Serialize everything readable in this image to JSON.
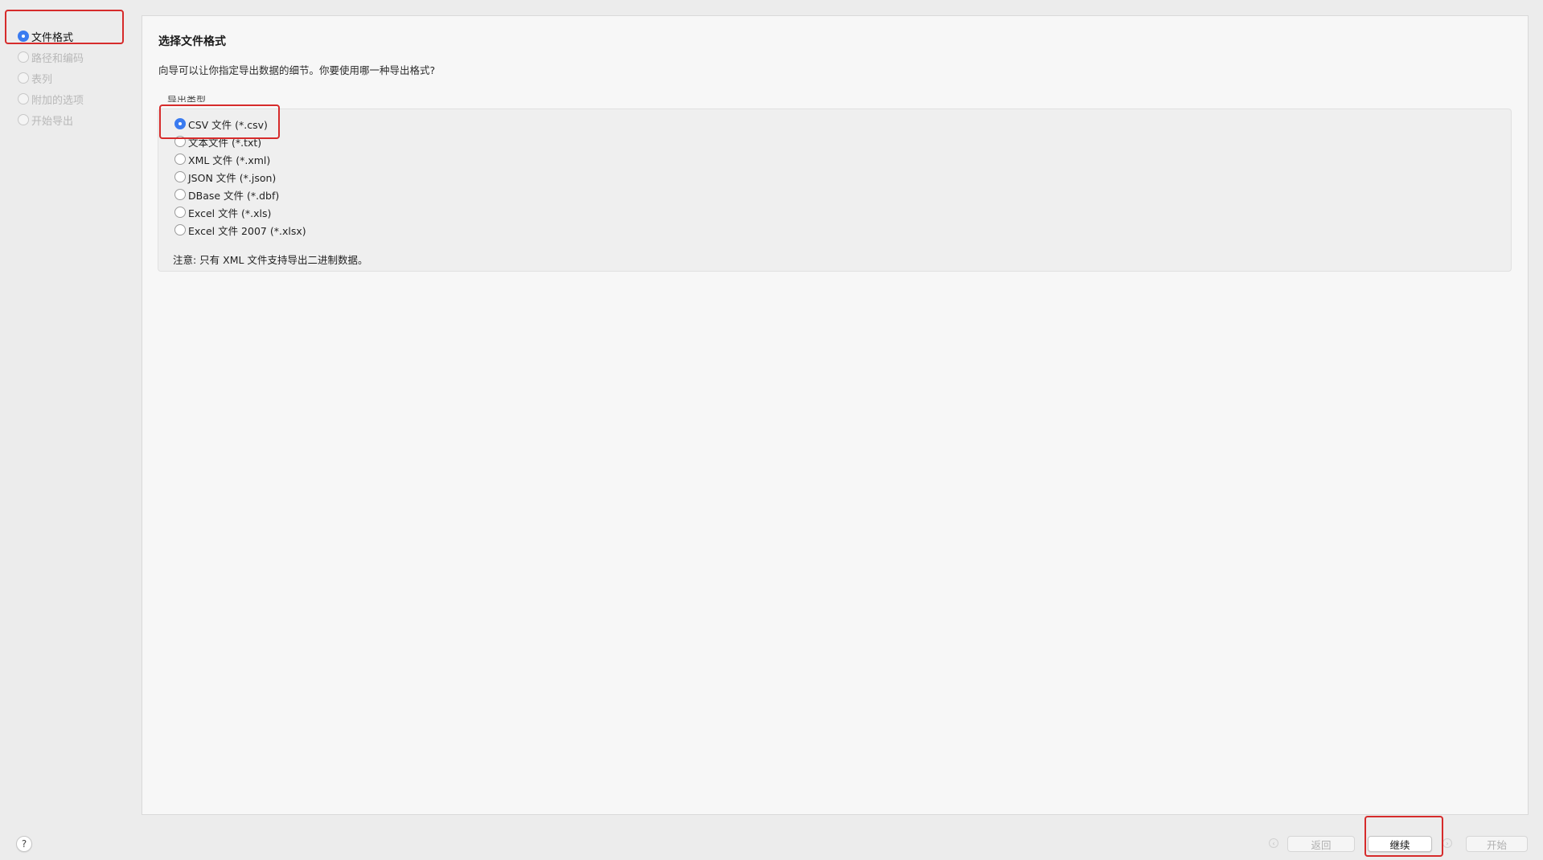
{
  "sidebar": {
    "steps": [
      {
        "label": "文件格式",
        "state": "done"
      },
      {
        "label": "路径和编码",
        "state": "disabled"
      },
      {
        "label": "表列",
        "state": "disabled"
      },
      {
        "label": "附加的选项",
        "state": "disabled"
      },
      {
        "label": "开始导出",
        "state": "disabled"
      }
    ]
  },
  "main": {
    "title": "选择文件格式",
    "description": "向导可以让你指定导出数据的细节。你要使用哪一种导出格式?",
    "group_label": "导出类型",
    "options": [
      {
        "label": "CSV 文件 (*.csv)",
        "selected": true
      },
      {
        "label": "文本文件 (*.txt)",
        "selected": false
      },
      {
        "label": "XML 文件 (*.xml)",
        "selected": false
      },
      {
        "label": "JSON 文件 (*.json)",
        "selected": false
      },
      {
        "label": "DBase 文件 (*.dbf)",
        "selected": false
      },
      {
        "label": "Excel 文件 (*.xls)",
        "selected": false
      },
      {
        "label": "Excel 文件 2007 (*.xlsx)",
        "selected": false
      }
    ],
    "note": "注意: 只有 XML 文件支持导出二进制数据。"
  },
  "footer": {
    "help_label": "?",
    "back_arrow": "‹",
    "back_label": "返回",
    "continue_label": "继续",
    "next_arrow": "›",
    "start_label": "开始"
  },
  "colors": {
    "accent": "#3a7bf0",
    "highlight_box": "#d62b2b"
  }
}
